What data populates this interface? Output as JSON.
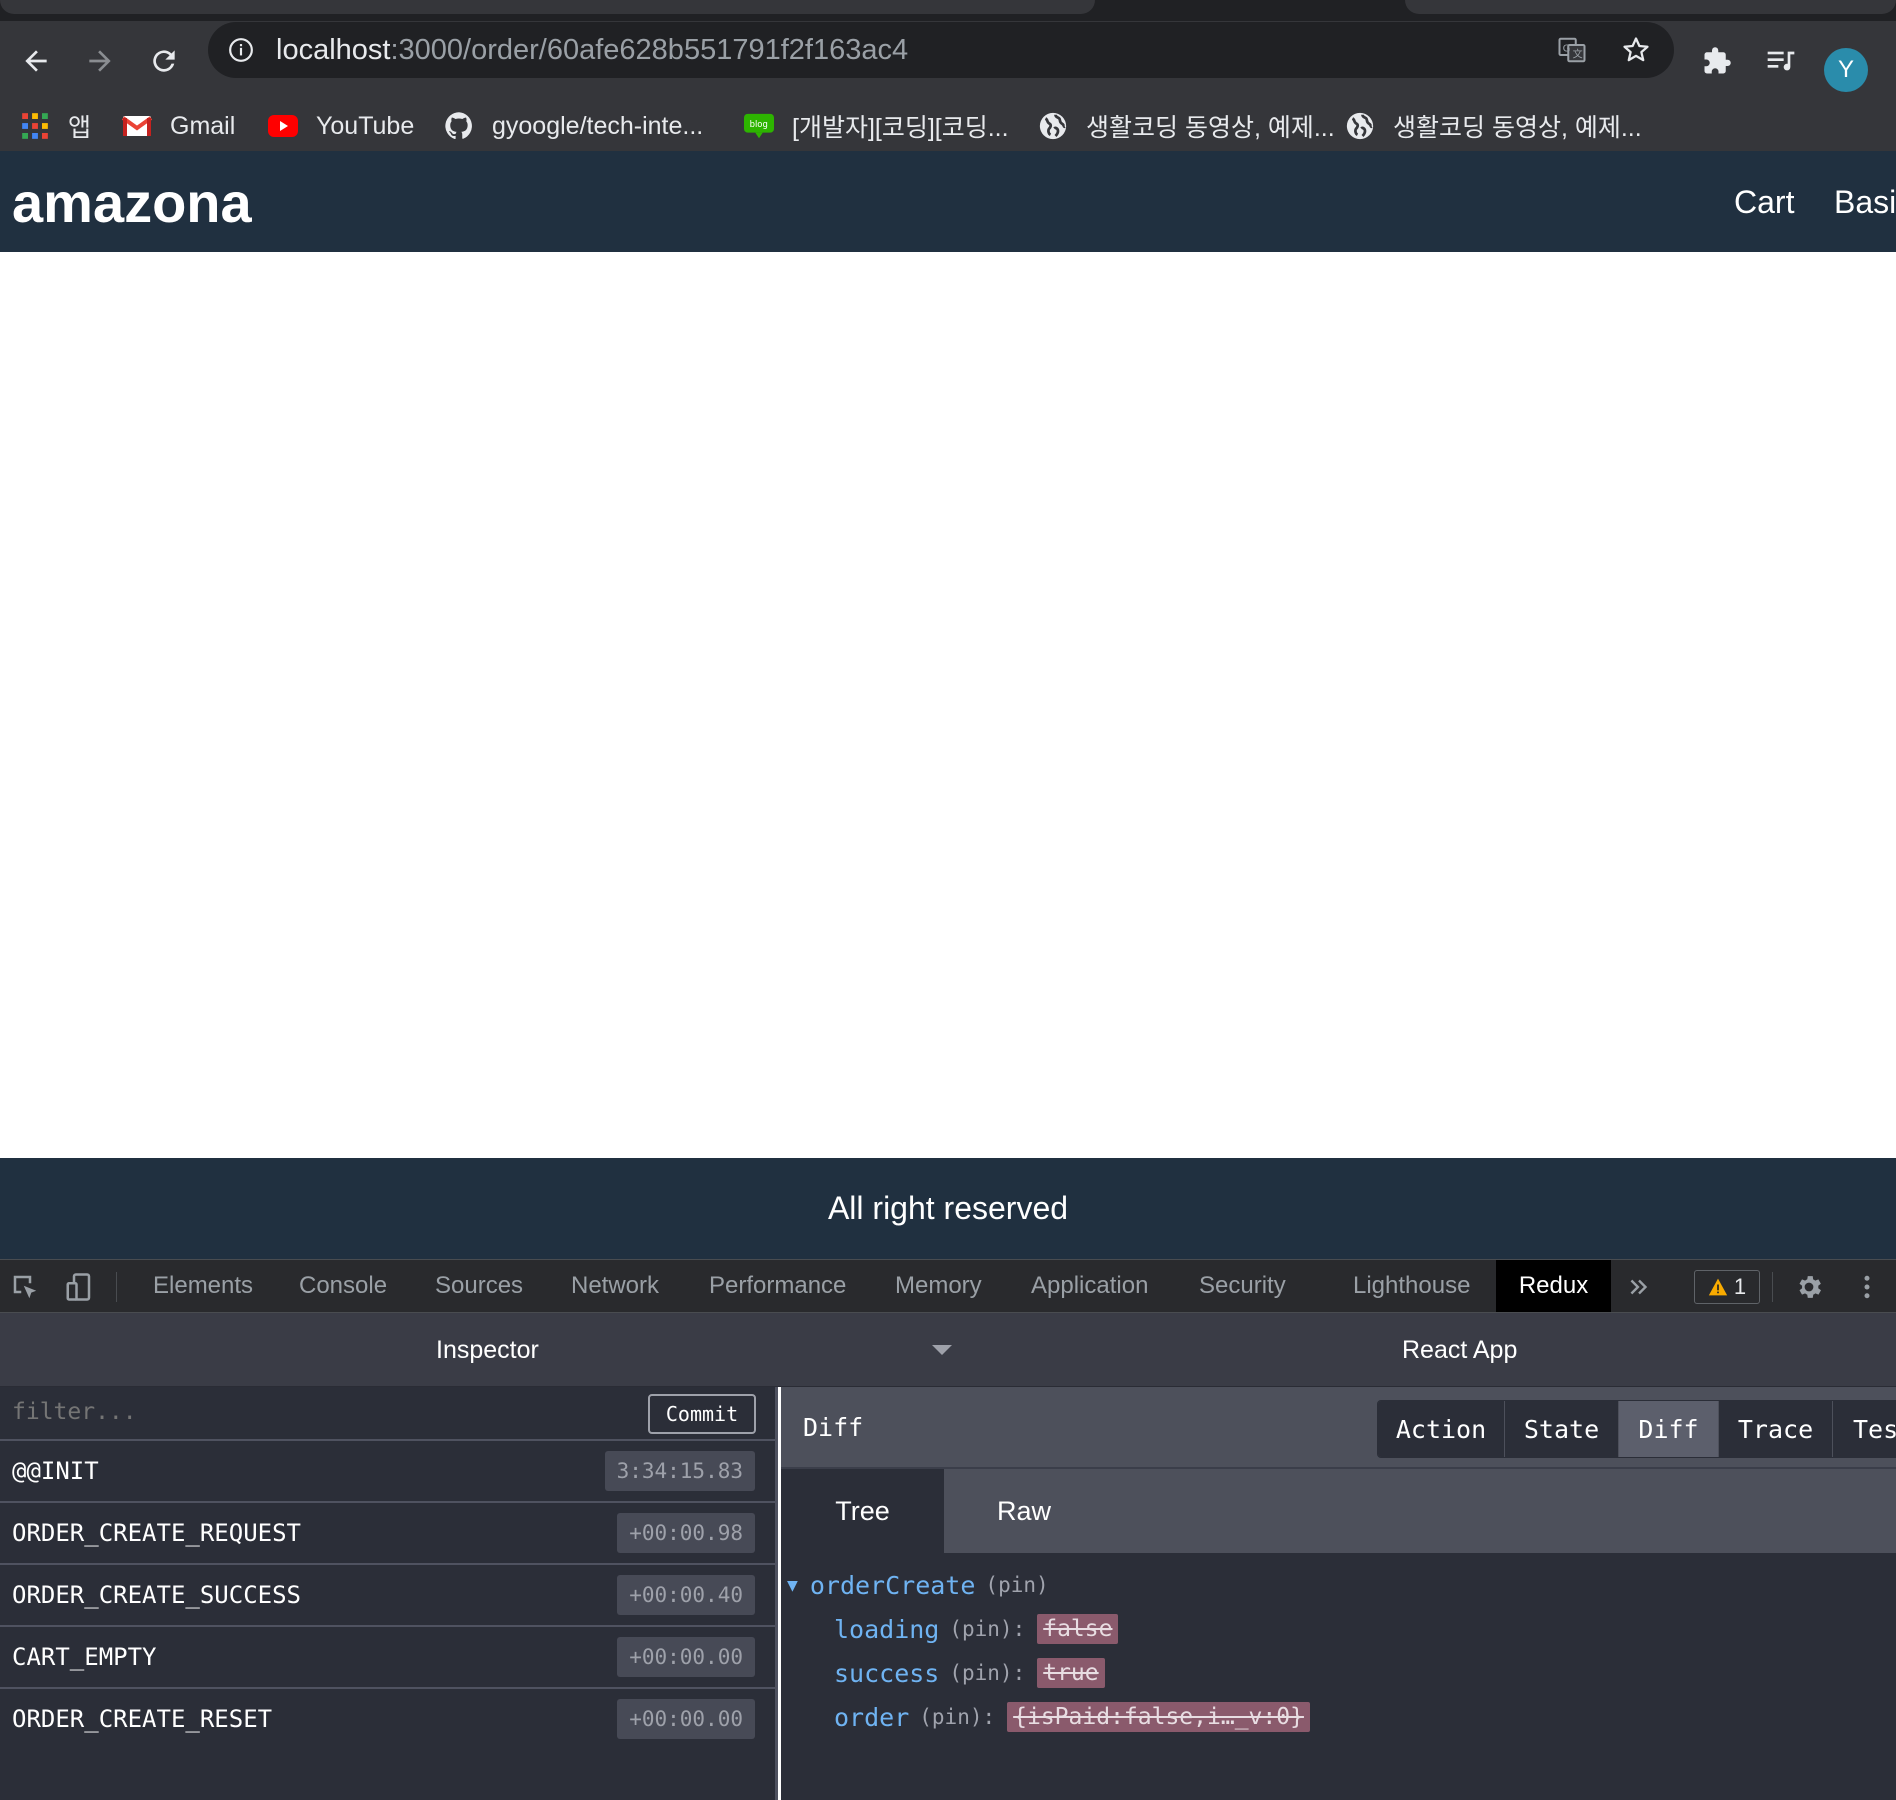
{
  "browser": {
    "url_host": "localhost",
    "url_path": ":3000/order/60afe628b551791f2f163ac4",
    "avatar_letter": "Y"
  },
  "bookmarks": [
    {
      "label": "앱",
      "icon": "apps-grid-icon"
    },
    {
      "label": "Gmail",
      "icon": "gmail-icon"
    },
    {
      "label": "YouTube",
      "icon": "youtube-icon"
    },
    {
      "label": "gyoogle/tech-inte...",
      "icon": "github-icon"
    },
    {
      "label": "[개발자][코딩][코딩...",
      "icon": "blog-icon"
    },
    {
      "label": "생활코딩 동영상, 예제...",
      "icon": "globe-icon"
    },
    {
      "label": "생활코딩 동영상, 예제...",
      "icon": "globe-icon"
    }
  ],
  "site": {
    "brand": "amazona",
    "nav": [
      "Cart",
      "Basi"
    ],
    "footer": "All right reserved",
    "header_color": "#203040"
  },
  "devtools": {
    "tabs": [
      "Elements",
      "Console",
      "Sources",
      "Network",
      "Performance",
      "Memory",
      "Application",
      "Security",
      "Lighthouse",
      "Redux"
    ],
    "active_tab": "Redux",
    "warning_count": "1"
  },
  "redux": {
    "inspector_title": "Inspector",
    "app_title": "React App",
    "filter_placeholder": "filter...",
    "commit_label": "Commit",
    "actions": [
      {
        "name": "@@INIT",
        "time": "3:34:15.83"
      },
      {
        "name": "ORDER_CREATE_REQUEST",
        "time": "+00:00.98"
      },
      {
        "name": "ORDER_CREATE_SUCCESS",
        "time": "+00:00.40"
      },
      {
        "name": "CART_EMPTY",
        "time": "+00:00.00"
      },
      {
        "name": "ORDER_CREATE_RESET",
        "time": "+00:00.00"
      }
    ],
    "panel_title": "Diff",
    "modes": [
      "Action",
      "State",
      "Diff",
      "Trace",
      "Tes"
    ],
    "active_mode": "Diff",
    "subtabs": [
      "Tree",
      "Raw"
    ],
    "active_subtab": "Tree",
    "tree": {
      "root_key": "orderCreate",
      "pin": "(pin)",
      "entries": [
        {
          "key": "loading",
          "pin": "(pin)",
          "colon": ":",
          "value": "false"
        },
        {
          "key": "success",
          "pin": "(pin)",
          "colon": ":",
          "value": "true"
        },
        {
          "key": "order",
          "pin": "(pin)",
          "colon": ":",
          "value": "{isPaid:false,i…_v:0}"
        }
      ]
    }
  }
}
